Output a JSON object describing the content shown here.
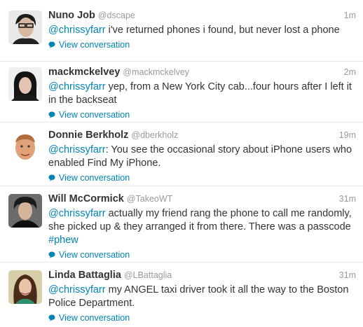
{
  "tweets": [
    {
      "fullname": "Nuno Job",
      "username": "@dscape",
      "time": "1m",
      "mention": "@chrissyfarr",
      "text": " i've returned phones i found, but never lost a phone",
      "view": "View conversation",
      "avatar_icon": "avatar-photo"
    },
    {
      "fullname": "mackmckelvey",
      "username": "@mackmckelvey",
      "time": "2m",
      "mention": "@chrissyfarr",
      "text": " yep, from a New York City cab...four hours after I left it in the backseat",
      "view": "View conversation",
      "avatar_icon": "avatar-photo"
    },
    {
      "fullname": "Donnie Berkholz",
      "username": "@dberkholz",
      "time": "19m",
      "mention": "@chrissyfarr",
      "text": ": You see the occasional story about iPhone users who enabled Find My iPhone.",
      "view": "View conversation",
      "avatar_icon": "avatar-photo"
    },
    {
      "fullname": "Will McCormick",
      "username": "@TakeoWT",
      "time": "31m",
      "mention": "@chrissyfarr",
      "text": " actually my friend rang the phone to call me randomly, she picked up & they arranged it from there. There was a passcode ",
      "hashtag": "#phew",
      "view": "View conversation",
      "avatar_icon": "avatar-photo"
    },
    {
      "fullname": "Linda Battaglia",
      "username": "@LBattaglia",
      "time": "31m",
      "mention": "@chrissyfarr",
      "text": " my ANGEL taxi driver took it all the way to the Boston Police Department.",
      "view": "View conversation",
      "avatar_icon": "avatar-photo"
    }
  ],
  "colors": {
    "link": "#0084b4",
    "text": "#333333",
    "muted": "#999999",
    "divider": "#e8e8e8"
  },
  "icons": {
    "conversation": "speech-bubble-icon"
  }
}
